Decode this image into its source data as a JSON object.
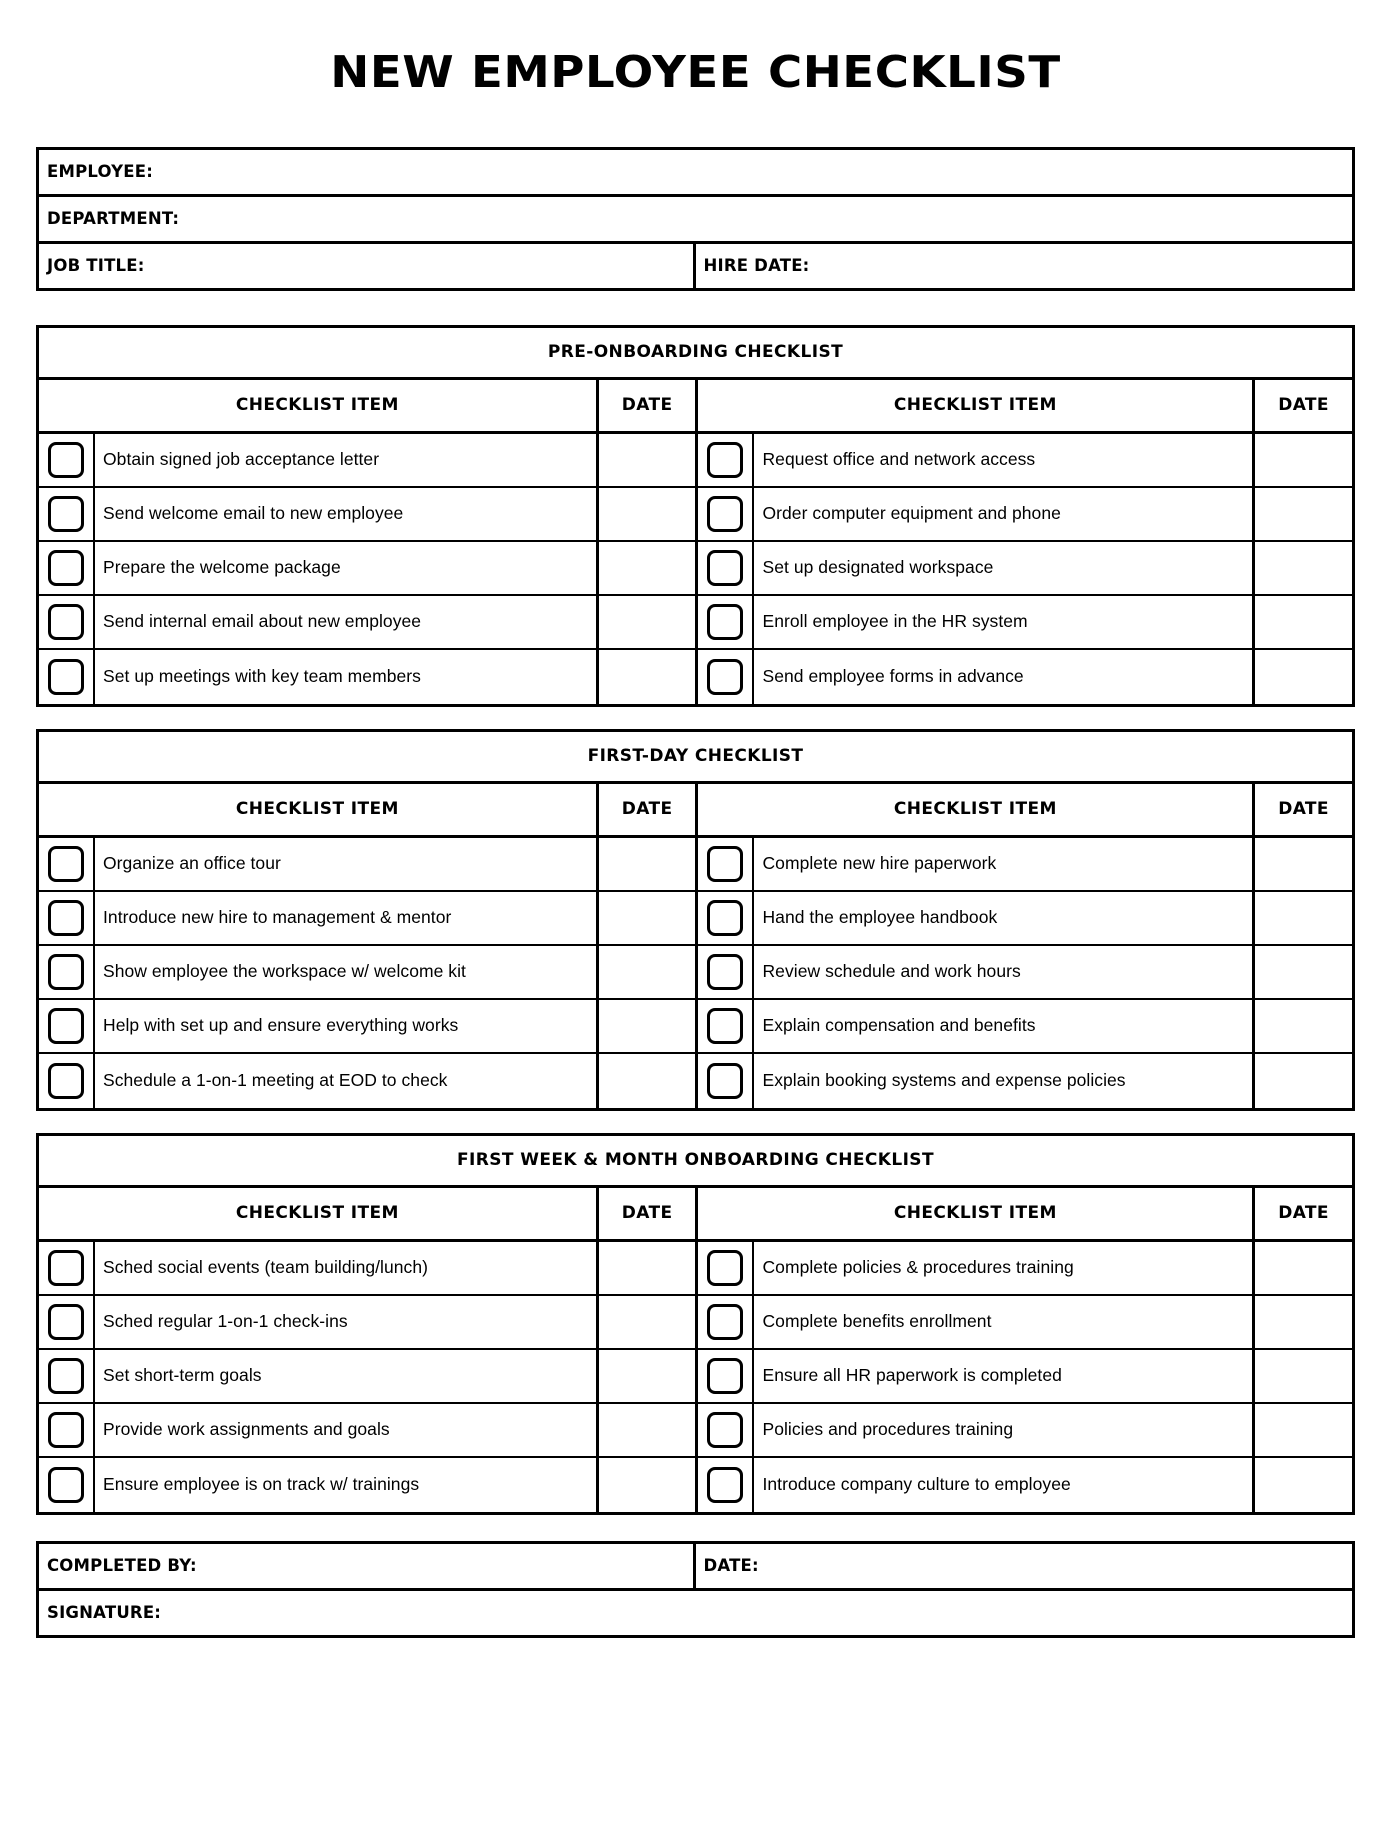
{
  "document": {
    "title": "NEW EMPLOYEE CHECKLIST"
  },
  "info": {
    "employee_label": "EMPLOYEE:",
    "department_label": "DEPARTMENT:",
    "job_title_label": "JOB TITLE:",
    "hire_date_label": "HIRE DATE:"
  },
  "columns": {
    "item": "CHECKLIST ITEM",
    "date": "DATE"
  },
  "sections": [
    {
      "title": "PRE-ONBOARDING CHECKLIST",
      "rows": [
        {
          "left": "Obtain signed job acceptance letter",
          "left_date": "",
          "right": "Request office and network access",
          "right_date": ""
        },
        {
          "left": "Send welcome email to new employee",
          "left_date": "",
          "right": "Order computer equipment and phone",
          "right_date": ""
        },
        {
          "left": "Prepare the welcome package",
          "left_date": "",
          "right": "Set up designated workspace",
          "right_date": ""
        },
        {
          "left": "Send internal email about new employee",
          "left_date": "",
          "right": "Enroll employee in the HR system",
          "right_date": ""
        },
        {
          "left": "Set up meetings with key team members",
          "left_date": "",
          "right": "Send employee forms in advance",
          "right_date": ""
        }
      ]
    },
    {
      "title": "FIRST-DAY CHECKLIST",
      "rows": [
        {
          "left": "Organize an office tour",
          "left_date": "",
          "right": "Complete new hire paperwork",
          "right_date": ""
        },
        {
          "left": "Introduce new hire to management & mentor",
          "left_date": "",
          "right": "Hand the employee handbook",
          "right_date": ""
        },
        {
          "left": "Show employee the workspace w/ welcome kit",
          "left_date": "",
          "right": "Review schedule and work hours",
          "right_date": ""
        },
        {
          "left": "Help with set up and ensure everything works",
          "left_date": "",
          "right": "Explain compensation and benefits",
          "right_date": ""
        },
        {
          "left": "Schedule a 1-on-1 meeting at EOD to check",
          "left_date": "",
          "right": "Explain booking systems and expense policies",
          "right_date": ""
        }
      ]
    },
    {
      "title": "FIRST WEEK & MONTH ONBOARDING CHECKLIST",
      "rows": [
        {
          "left": "Sched social events (team building/lunch)",
          "left_date": "",
          "right": "Complete policies & procedures training",
          "right_date": ""
        },
        {
          "left": "Sched regular 1-on-1 check-ins",
          "left_date": "",
          "right": "Complete benefits enrollment",
          "right_date": ""
        },
        {
          "left": "Set short-term goals",
          "left_date": "",
          "right": "Ensure all HR paperwork is completed",
          "right_date": ""
        },
        {
          "left": "Provide work assignments and goals",
          "left_date": "",
          "right": "Policies and procedures training",
          "right_date": ""
        },
        {
          "left": "Ensure employee is on track w/ trainings",
          "left_date": "",
          "right": "Introduce company culture to employee",
          "right_date": ""
        }
      ]
    }
  ],
  "footer": {
    "completed_by_label": "COMPLETED BY:",
    "date_label": "DATE:",
    "signature_label": "SIGNATURE:"
  },
  "colors": {
    "ink": "#000000",
    "paper": "#ffffff"
  }
}
